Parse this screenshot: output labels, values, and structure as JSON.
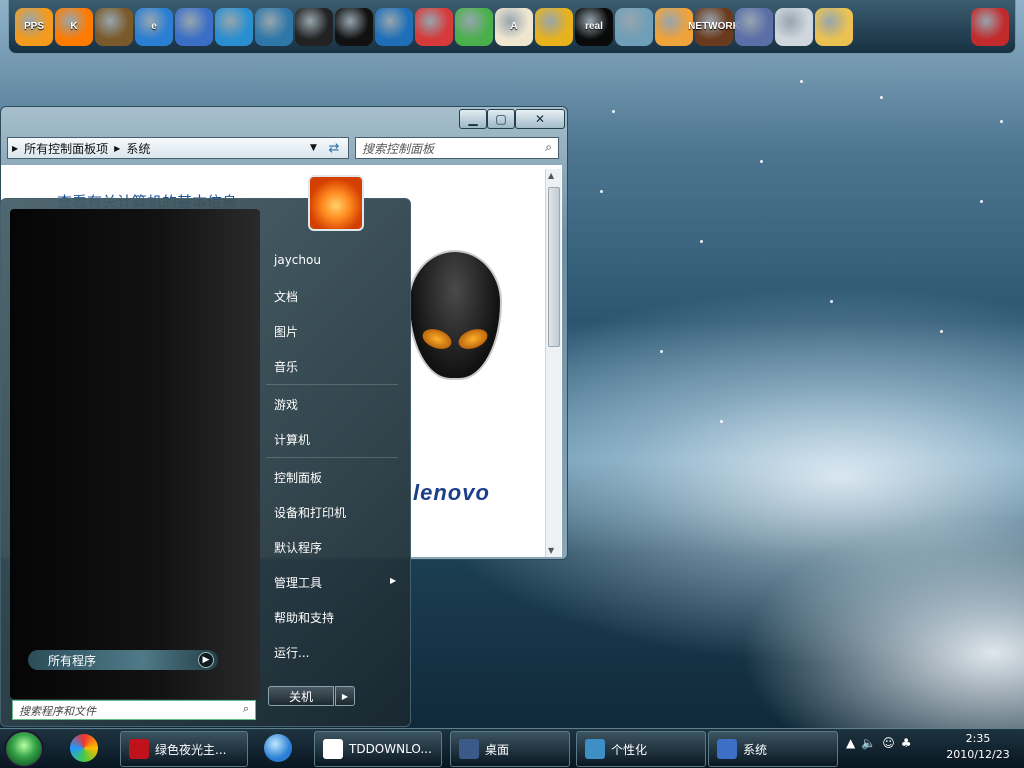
{
  "dock": {
    "icons": [
      {
        "name": "pps-icon",
        "label": "PPS",
        "color": "#f29b1d"
      },
      {
        "name": "qvod-icon",
        "label": "K",
        "color": "#ff7b00"
      },
      {
        "name": "plants-game-icon",
        "label": "",
        "color": "#7a5a2a"
      },
      {
        "name": "ie-icon",
        "label": "e",
        "color": "#2a7fd4"
      },
      {
        "name": "remote-desktop-icon",
        "label": "",
        "color": "#3b6fc6"
      },
      {
        "name": "feedback-icon",
        "label": "",
        "color": "#2a8fd0"
      },
      {
        "name": "monitor-icon",
        "label": "",
        "color": "#2f77a8"
      },
      {
        "name": "sogou-icon",
        "label": "",
        "color": "#222222"
      },
      {
        "name": "qq-penguin-icon",
        "label": "",
        "color": "#111111"
      },
      {
        "name": "browser-icon",
        "label": "",
        "color": "#1f6fb8"
      },
      {
        "name": "360-safe-icon",
        "label": "",
        "color": "#d63a3a"
      },
      {
        "name": "update-icon",
        "label": "",
        "color": "#4bb04b"
      },
      {
        "name": "solitaire-icon",
        "label": "A",
        "color": "#efe6d0"
      },
      {
        "name": "paint-icon",
        "label": "",
        "color": "#e8b21c"
      },
      {
        "name": "realplayer-icon",
        "label": "real",
        "color": "#0a0a0a"
      },
      {
        "name": "water-drop-icon",
        "label": "",
        "color": "#6f9fb8"
      },
      {
        "name": "messenger-icon",
        "label": "",
        "color": "#f0a23b"
      },
      {
        "name": "network-icon",
        "label": "NETWORK",
        "color": "#6a3a1e"
      },
      {
        "name": "windows-flag-icon",
        "label": "",
        "color": "#5b6ea8"
      },
      {
        "name": "server-icon",
        "label": "",
        "color": "#cfd6de"
      },
      {
        "name": "folder-icon",
        "label": "",
        "color": "#e9c253"
      },
      {
        "name": "game-console-icon",
        "label": "",
        "color": "#c22b2b"
      }
    ]
  },
  "window": {
    "address": {
      "root": "所有控制面板项",
      "current": "系统"
    },
    "search_placeholder": "搜索控制面板",
    "heading": "查看有关计算机的基本信息",
    "brand": "lenovo"
  },
  "start_menu": {
    "all_programs": "所有程序",
    "search_placeholder": "搜索程序和文件",
    "user": "jaychou",
    "items": [
      "文档",
      "图片",
      "音乐",
      "游戏",
      "计算机",
      "控制面板",
      "设备和打印机",
      "默认程序",
      "管理工具",
      "帮助和支持",
      "运行..."
    ],
    "shutdown": "关机"
  },
  "taskbar": {
    "buttons": [
      {
        "label": "绿色夜光主...",
        "color": "#c0121a"
      },
      {
        "label": "TDDOWNLO...",
        "color": "#ffffff"
      },
      {
        "label": "桌面",
        "color": "#3a5a8a"
      },
      {
        "label": "个性化",
        "color": "#3d8fc6"
      },
      {
        "label": "系统",
        "color": "#3d6fc6"
      }
    ],
    "clock": {
      "time": "2:35",
      "date": "2010/12/23"
    }
  }
}
